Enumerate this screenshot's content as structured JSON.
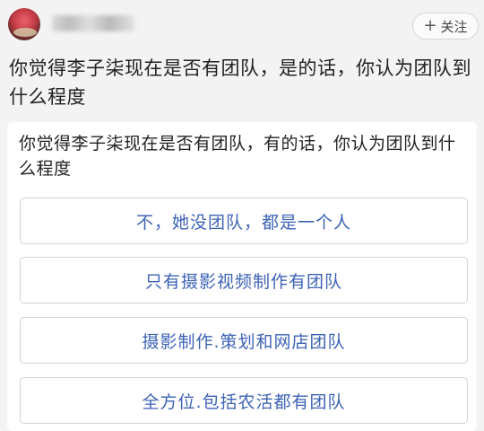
{
  "header": {
    "follow_label": "关注",
    "follow_icon": "+"
  },
  "question": {
    "title": "你觉得李子柒现在是否有团队，是的话，你认为团队到什么程度"
  },
  "poll": {
    "question": "你觉得李子柒现在是否有团队，有的话，你认为团队到什么程度",
    "options": [
      {
        "label": "不，她没团队，都是一个人"
      },
      {
        "label": "只有摄影视频制作有团队"
      },
      {
        "label": "摄影制作.策划和网店团队"
      },
      {
        "label": "全方位.包括农活都有团队"
      }
    ]
  },
  "colors": {
    "option_text": "#3d63b5",
    "background": "#f3f3f3",
    "card": "#ffffff"
  }
}
